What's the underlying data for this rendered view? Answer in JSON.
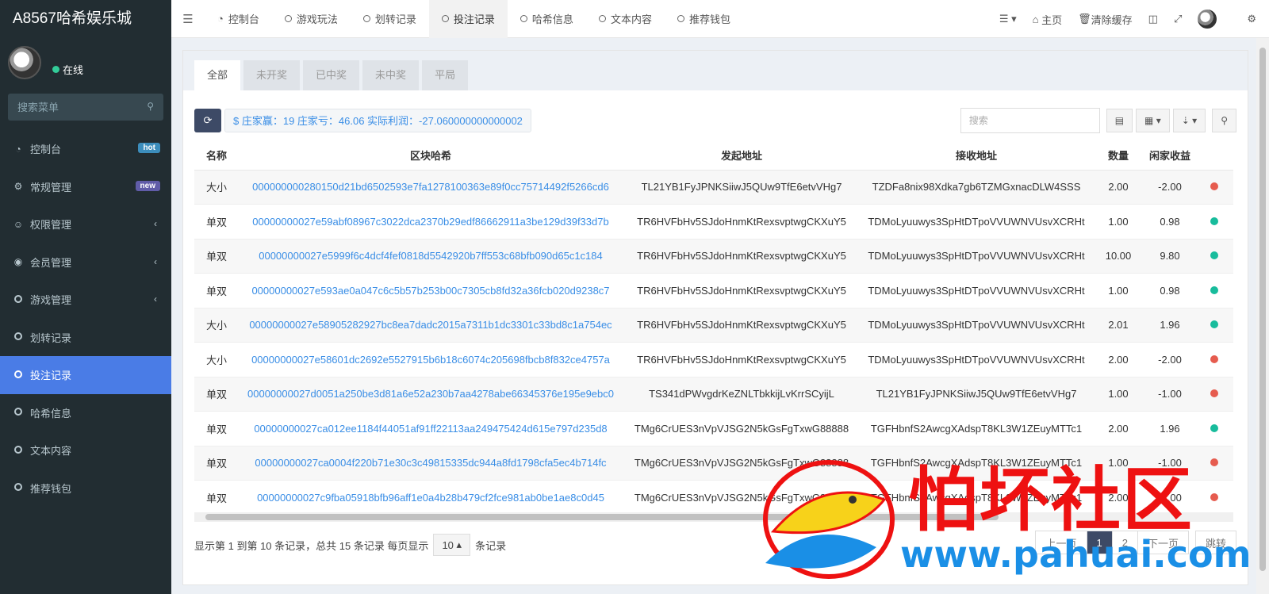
{
  "brand": "A8567哈希娱乐城",
  "user": {
    "status": "在线"
  },
  "sidebar": {
    "search_placeholder": "搜索菜单",
    "items": [
      {
        "label": "控制台",
        "icon": "dashboard-icon",
        "badge": "hot",
        "badge_color": "#3c8dbc"
      },
      {
        "label": "常规管理",
        "icon": "cogs-icon",
        "badge": "new",
        "badge_color": "#605ca8"
      },
      {
        "label": "权限管理",
        "icon": "group-icon"
      },
      {
        "label": "会员管理",
        "icon": "user-circle-icon"
      },
      {
        "label": "游戏管理",
        "icon": "circle-icon"
      },
      {
        "label": "划转记录",
        "icon": "circle-icon"
      },
      {
        "label": "投注记录",
        "icon": "circle-icon",
        "active": true
      },
      {
        "label": "哈希信息",
        "icon": "circle-icon"
      },
      {
        "label": "文本内容",
        "icon": "circle-icon"
      },
      {
        "label": "推荐钱包",
        "icon": "circle-icon"
      }
    ]
  },
  "topbar": {
    "tabs": [
      "控制台",
      "游戏玩法",
      "划转记录",
      "投注记录",
      "哈希信息",
      "文本内容",
      "推荐钱包"
    ],
    "active_tab": "投注记录",
    "home": "主页",
    "clear_cache": "清除缓存"
  },
  "filters": [
    "全部",
    "未开奖",
    "已中奖",
    "未中奖",
    "平局"
  ],
  "stats": "$ 庄家赢：19 庄家亏：46.06 实际利润：-27.060000000000002",
  "search_placeholder": "搜索",
  "table": {
    "headers": [
      "名称",
      "区块哈希",
      "发起地址",
      "接收地址",
      "数量",
      "闲家收益"
    ],
    "rows": [
      {
        "name": "大小",
        "hash": "000000000280150d21bd6502593e7fa1278100363e89f0cc75714492f5266cd6",
        "from": "TL21YB1FyJPNKSiiwJ5QUw9TfE6etvVHg7",
        "to": "TZDFa8nix98Xdka7gb6TZMGxnacDLW4SSS",
        "amount": "2.00",
        "profit": "-2.00",
        "status_color": "#e65c4f"
      },
      {
        "name": "单双",
        "hash": "00000000027e59abf08967c3022dca2370b29edf86662911a3be129d39f33d7b",
        "from": "TR6HVFbHv5SJdoHnmKtRexsvptwgCKXuY5",
        "to": "TDMoLyuuwys3SpHtDTpoVVUWNVUsvXCRHt",
        "amount": "1.00",
        "profit": "0.98",
        "status_color": "#18bc9c"
      },
      {
        "name": "单双",
        "hash": "00000000027e5999f6c4dcf4fef0818d5542920b7ff553c68bfb090d65c1c184",
        "from": "TR6HVFbHv5SJdoHnmKtRexsvptwgCKXuY5",
        "to": "TDMoLyuuwys3SpHtDTpoVVUWNVUsvXCRHt",
        "amount": "10.00",
        "profit": "9.80",
        "status_color": "#18bc9c"
      },
      {
        "name": "单双",
        "hash": "00000000027e593ae0a047c6c5b57b253b00c7305cb8fd32a36fcb020d9238c7",
        "from": "TR6HVFbHv5SJdoHnmKtRexsvptwgCKXuY5",
        "to": "TDMoLyuuwys3SpHtDTpoVVUWNVUsvXCRHt",
        "amount": "1.00",
        "profit": "0.98",
        "status_color": "#18bc9c"
      },
      {
        "name": "大小",
        "hash": "00000000027e58905282927bc8ea7dadc2015a7311b1dc3301c33bd8c1a754ec",
        "from": "TR6HVFbHv5SJdoHnmKtRexsvptwgCKXuY5",
        "to": "TDMoLyuuwys3SpHtDTpoVVUWNVUsvXCRHt",
        "amount": "2.01",
        "profit": "1.96",
        "status_color": "#18bc9c"
      },
      {
        "name": "大小",
        "hash": "00000000027e58601dc2692e5527915b6b18c6074c205698fbcb8f832ce4757a",
        "from": "TR6HVFbHv5SJdoHnmKtRexsvptwgCKXuY5",
        "to": "TDMoLyuuwys3SpHtDTpoVVUWNVUsvXCRHt",
        "amount": "2.00",
        "profit": "-2.00",
        "status_color": "#e65c4f"
      },
      {
        "name": "单双",
        "hash": "00000000027d0051a250be3d81a6e52a230b7aa4278abe66345376e195e9ebc0",
        "from": "TS341dPWvgdrKeZNLTbkkijLvKrrSCyijL",
        "to": "TL21YB1FyJPNKSiiwJ5QUw9TfE6etvVHg7",
        "amount": "1.00",
        "profit": "-1.00",
        "status_color": "#e65c4f"
      },
      {
        "name": "单双",
        "hash": "00000000027ca012ee1184f44051af91ff22113aa249475424d615e797d235d8",
        "from": "TMg6CrUES3nVpVJSG2N5kGsFgTxwG88888",
        "to": "TGFHbnfS2AwcgXAdspT8KL3W1ZEuyMTTc1",
        "amount": "2.00",
        "profit": "1.96",
        "status_color": "#18bc9c"
      },
      {
        "name": "单双",
        "hash": "00000000027ca0004f220b71e30c3c49815335dc944a8fd1798cfa5ec4b714fc",
        "from": "TMg6CrUES3nVpVJSG2N5kGsFgTxwG88888",
        "to": "TGFHbnfS2AwcgXAdspT8KL3W1ZEuyMTTc1",
        "amount": "1.00",
        "profit": "-1.00",
        "status_color": "#e65c4f"
      },
      {
        "name": "单双",
        "hash": "00000000027c9fba05918bfb96aff1e0a4b28b479cf2fce981ab0be1ae8c0d45",
        "from": "TMg6CrUES3nVpVJSG2N5kGsFgTxwG88888",
        "to": "TGFHbnfS2AwcgXAdspT8KL3W1ZEuyMTTc1",
        "amount": "2.00",
        "profit": "-2.00",
        "status_color": "#e65c4f"
      }
    ]
  },
  "footer": {
    "summary": "显示第 1 到第 10 条记录，总共 15 条记录 每页显示",
    "page_size": "10",
    "suffix": "条记录"
  },
  "pager": {
    "prev": "上一页",
    "pages": [
      "1",
      "2"
    ],
    "next": "下一页",
    "jump": "跳转"
  },
  "watermark": {
    "text": "怕坏社区",
    "url": "www.pahuai.com"
  }
}
